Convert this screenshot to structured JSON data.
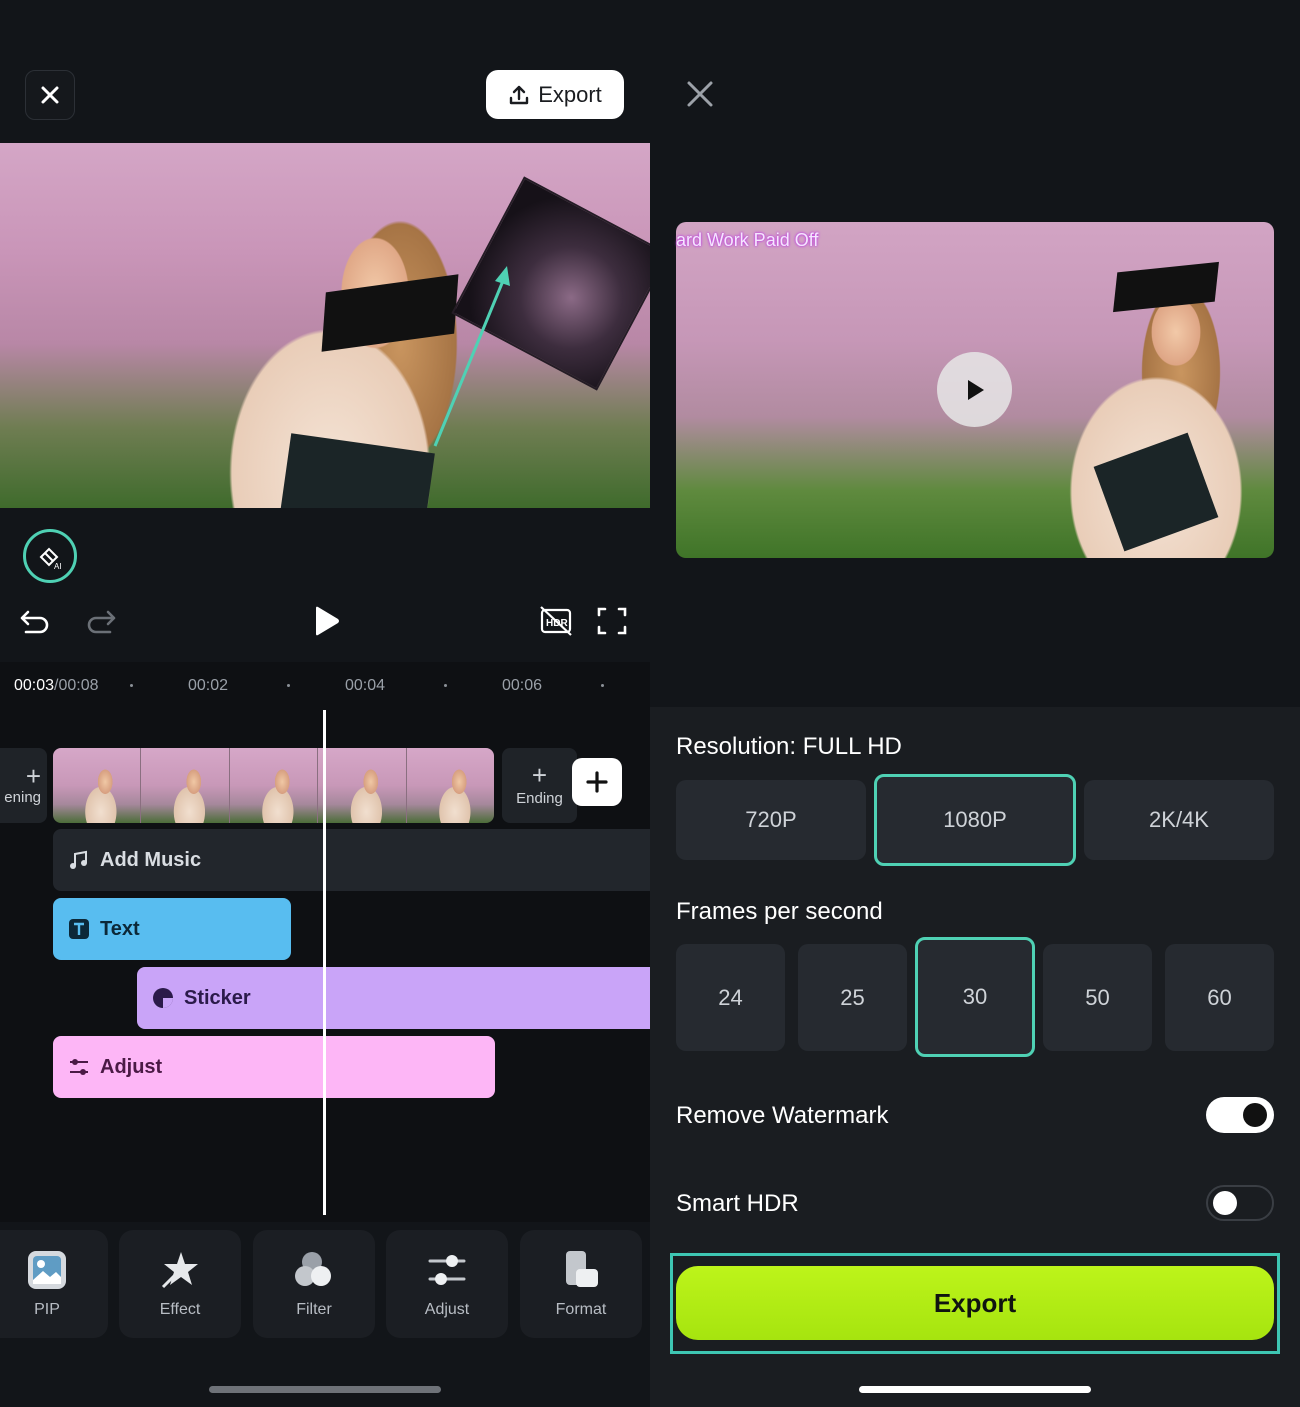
{
  "editor": {
    "export_label": "Export",
    "time": {
      "current": "00:03",
      "total": "/00:08"
    },
    "ruler": [
      "00:02",
      "00:04",
      "00:06"
    ],
    "opening_label": "ening",
    "ending_label": "Ending",
    "plus_glyph": "+",
    "tracks": {
      "music": "Add Music",
      "text": "Text",
      "sticker": "Sticker",
      "adjust": "Adjust"
    },
    "toolbar": [
      {
        "label": "PIP",
        "icon": "pip-icon"
      },
      {
        "label": "Effect",
        "icon": "effect-icon"
      },
      {
        "label": "Filter",
        "icon": "filter-icon"
      },
      {
        "label": "Adjust",
        "icon": "adjust-icon"
      },
      {
        "label": "Format",
        "icon": "format-icon"
      }
    ]
  },
  "export_panel": {
    "watermark_text": "ard Work Paid Off",
    "resolution_title": "Resolution: FULL HD",
    "resolutions": [
      "720P",
      "1080P",
      "2K/4K"
    ],
    "selected_resolution": "1080P",
    "fps_title": "Frames per second",
    "fps_options": [
      "24",
      "25",
      "30",
      "50",
      "60"
    ],
    "selected_fps": "30",
    "remove_watermark": {
      "label": "Remove Watermark",
      "on": true
    },
    "smart_hdr": {
      "label": "Smart HDR",
      "on": false
    },
    "export_label": "Export"
  },
  "colors": {
    "accent": "#4fd1b4",
    "export_green": "#b4ee15",
    "text_track": "#58bdf0",
    "sticker_track": "#c9a4f8",
    "adjust_track": "#fdb6f6"
  }
}
